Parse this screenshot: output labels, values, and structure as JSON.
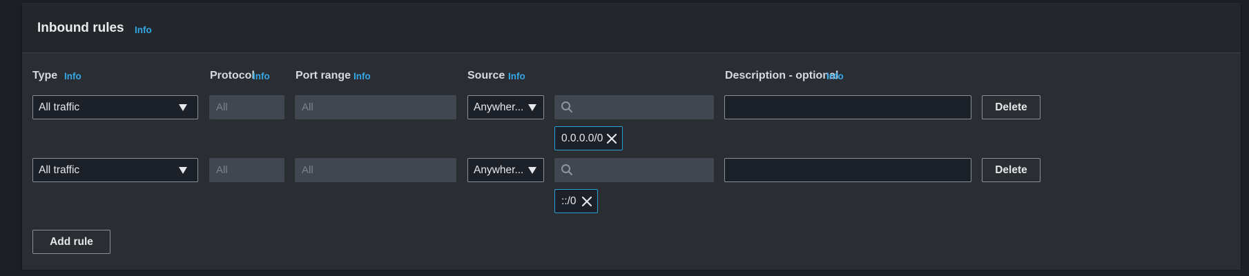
{
  "section": {
    "title": "Inbound rules",
    "info_label": "Info"
  },
  "columns": {
    "type": "Type",
    "protocol": "Protocol",
    "port_range": "Port range",
    "source": "Source",
    "description": "Description - optional",
    "info_label": "Info"
  },
  "rules": [
    {
      "type": "All traffic",
      "protocol": "All",
      "port_range": "All",
      "source": "Anywher...",
      "search_value": "",
      "token": "0.0.0.0/0",
      "description": "",
      "delete_label": "Delete"
    },
    {
      "type": "All traffic",
      "protocol": "All",
      "port_range": "All",
      "source": "Anywher...",
      "search_value": "",
      "token": "::/0",
      "description": "",
      "delete_label": "Delete"
    }
  ],
  "add_rule_label": "Add rule",
  "colors": {
    "info_link": "#35a7e6",
    "token_border": "#28a1d6",
    "panel_bg": "#2a2e33",
    "header_bg": "#23272c"
  },
  "icons": {
    "dropdown": "caret-down-icon",
    "search": "search-icon",
    "remove_token": "close-icon"
  }
}
